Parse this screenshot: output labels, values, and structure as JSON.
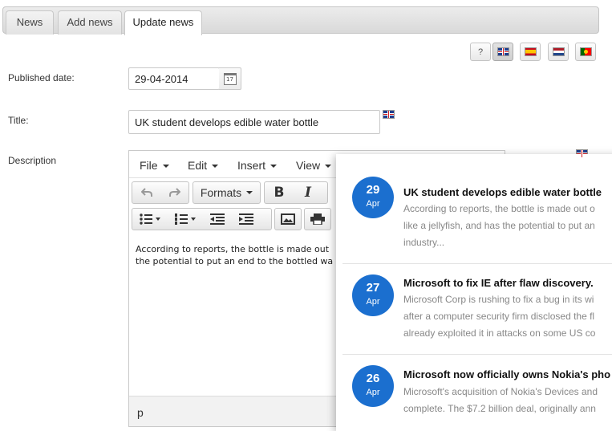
{
  "tabs": [
    {
      "label": "News"
    },
    {
      "label": "Add news"
    },
    {
      "label": "Update news",
      "active": true
    }
  ],
  "lang_bar": {
    "help_label": "?",
    "languages": [
      {
        "name": "english",
        "flag": "uk-flag-icon",
        "active": true
      },
      {
        "name": "spanish",
        "flag": "es-flag-icon"
      },
      {
        "name": "dutch",
        "flag": "nl-flag-icon"
      },
      {
        "name": "portuguese",
        "flag": "pt-flag-icon"
      }
    ]
  },
  "form": {
    "published_label": "Published date:",
    "published_value": "29-04-2014",
    "calendar_icon_text": "17",
    "title_label": "Title:",
    "title_value": "UK student develops edible water bottle",
    "description_label": "Description"
  },
  "editor": {
    "menus": [
      "File",
      "Edit",
      "Insert",
      "View"
    ],
    "formats_label": "Formats",
    "bold_label": "B",
    "italic_label": "I",
    "content_line1": "According to reports, the bottle is made out",
    "content_line2": "the potential to put an end to the bottled wa",
    "status_path": "p"
  },
  "news": [
    {
      "day": "29",
      "month": "Apr",
      "title": "UK student develops edible water bottle",
      "line1": "According to reports, the bottle is made out o",
      "line2": "like a jellyfish, and has the potential to put an",
      "line3": "industry..."
    },
    {
      "day": "27",
      "month": "Apr",
      "title": "Microsoft to fix IE after flaw discovery.",
      "line1": "Microsoft Corp is rushing to fix a bug in its wi",
      "line2": "after a computer security firm disclosed the fl",
      "line3": "already exploited it in attacks on some US co"
    },
    {
      "day": "26",
      "month": "Apr",
      "title": "Microsoft now officially owns Nokia's pho",
      "line1": "Microsoft's acquisition of Nokia's Devices and",
      "line2": "complete. The $7.2 billion deal, originally ann",
      "line3": ""
    }
  ],
  "colors": {
    "badge": "#1b6fcf",
    "tab_bar": "#dddddd"
  }
}
